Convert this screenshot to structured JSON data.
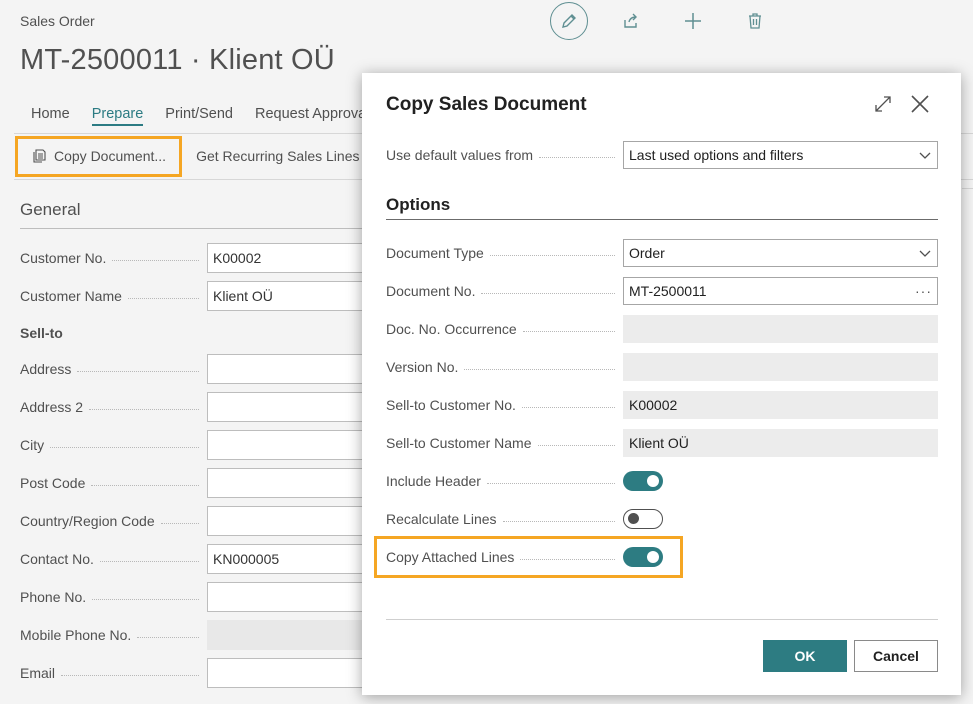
{
  "page": {
    "caption": "Sales Order",
    "title": "MT-2500011 · Klient OÜ",
    "top_actions": [
      "edit-icon",
      "share-icon",
      "add-icon",
      "delete-icon"
    ],
    "nav": [
      "Home",
      "Prepare",
      "Print/Send",
      "Request Approval"
    ],
    "nav_active": "Prepare",
    "actions": {
      "copy_document": "Copy Document...",
      "get_recurring": "Get Recurring Sales Lines"
    },
    "section_title": "General",
    "sell_to_heading": "Sell-to",
    "fields": {
      "customer_no": {
        "label": "Customer No.",
        "value": "K00002"
      },
      "customer_name": {
        "label": "Customer Name",
        "value": "Klient OÜ"
      },
      "address": {
        "label": "Address",
        "value": ""
      },
      "address2": {
        "label": "Address 2",
        "value": ""
      },
      "city": {
        "label": "City",
        "value": ""
      },
      "post_code": {
        "label": "Post Code",
        "value": ""
      },
      "country": {
        "label": "Country/Region Code",
        "value": ""
      },
      "contact_no": {
        "label": "Contact No.",
        "value": "KN000005"
      },
      "phone_no": {
        "label": "Phone No.",
        "value": ""
      },
      "mobile_phone": {
        "label": "Mobile Phone No.",
        "value": ""
      },
      "email": {
        "label": "Email",
        "value": ""
      }
    }
  },
  "dialog": {
    "title": "Copy Sales Document",
    "default_values": {
      "label": "Use default values from",
      "value": "Last used options and filters"
    },
    "options_title": "Options",
    "document_type": {
      "label": "Document Type",
      "value": "Order"
    },
    "document_no": {
      "label": "Document No.",
      "value": "MT-2500011"
    },
    "doc_no_occurrence": {
      "label": "Doc. No. Occurrence",
      "value": ""
    },
    "version_no": {
      "label": "Version No.",
      "value": ""
    },
    "sell_to_customer_no": {
      "label": "Sell-to Customer No.",
      "value": "K00002"
    },
    "sell_to_customer_name": {
      "label": "Sell-to Customer Name",
      "value": "Klient OÜ"
    },
    "include_header": {
      "label": "Include Header",
      "on": true
    },
    "recalculate_lines": {
      "label": "Recalculate Lines",
      "on": false
    },
    "copy_attached_lines": {
      "label": "Copy Attached Lines",
      "on": true
    },
    "ok": "OK",
    "cancel": "Cancel"
  },
  "colors": {
    "accent": "#2d7c82",
    "highlight": "#f5a623"
  }
}
